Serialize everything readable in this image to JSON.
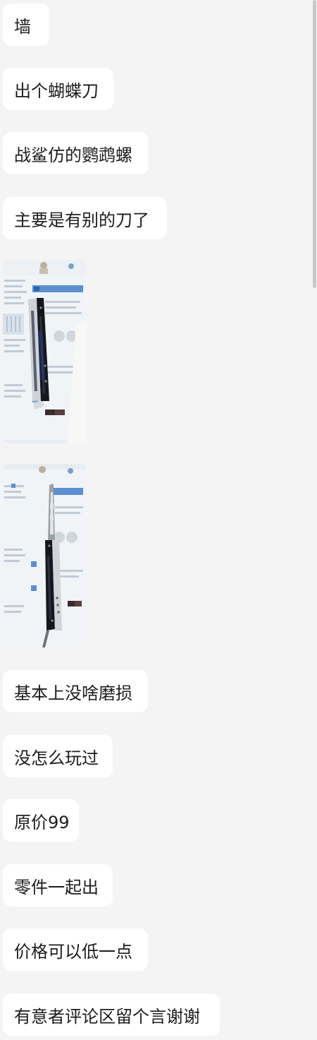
{
  "chat": {
    "messages": [
      {
        "text": "墙"
      },
      {
        "text": "出个蝴蝶刀"
      },
      {
        "text": "战鲨仿的鹦鹉螺"
      },
      {
        "text": "主要是有别的刀了"
      },
      {
        "text": "基本上没啥磨损"
      },
      {
        "text": "没怎么玩过"
      },
      {
        "text": "原价99"
      },
      {
        "text": "零件一起出"
      },
      {
        "text": "价格可以低一点"
      },
      {
        "text": "有意者评论区留个言谢谢"
      }
    ],
    "photos": [
      {
        "subject": "butterfly knife closed on workbook"
      },
      {
        "subject": "butterfly knife open on workbook"
      }
    ]
  },
  "colors": {
    "background": "#f4f4f5",
    "bubble": "#ffffff",
    "text": "#1c1c1c"
  }
}
